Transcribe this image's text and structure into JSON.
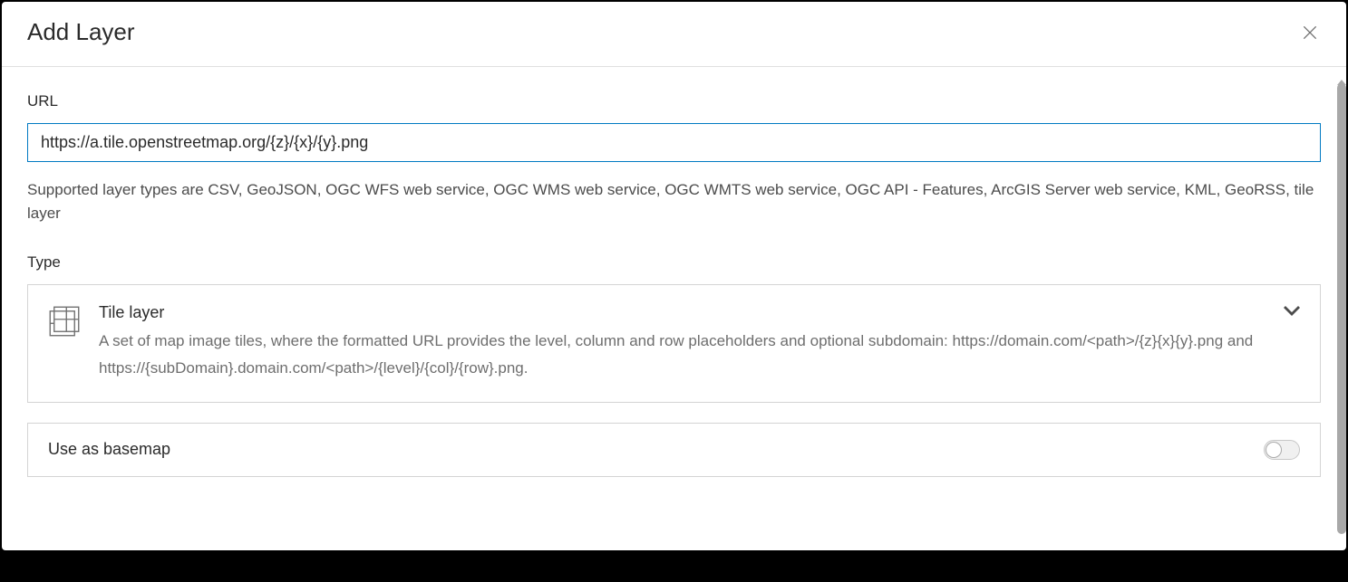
{
  "dialog": {
    "title": "Add Layer"
  },
  "url": {
    "label": "URL",
    "value": "https://a.tile.openstreetmap.org/{z}/{x}/{y}.png",
    "help": "Supported layer types are CSV, GeoJSON, OGC WFS web service, OGC WMS web service, OGC WMTS web service, OGC API - Features, ArcGIS Server web service, KML, GeoRSS, tile layer"
  },
  "type": {
    "label": "Type",
    "selected": {
      "title": "Tile layer",
      "desc": "A set of map image tiles, where the formatted URL provides the level, column and row placeholders and optional subdomain: https://domain.com/<path>/{z}{x}{y}.png and https://{subDomain}.domain.com/<path>/{level}/{col}/{row}.png."
    }
  },
  "basemap": {
    "label": "Use as basemap",
    "enabled": false
  }
}
